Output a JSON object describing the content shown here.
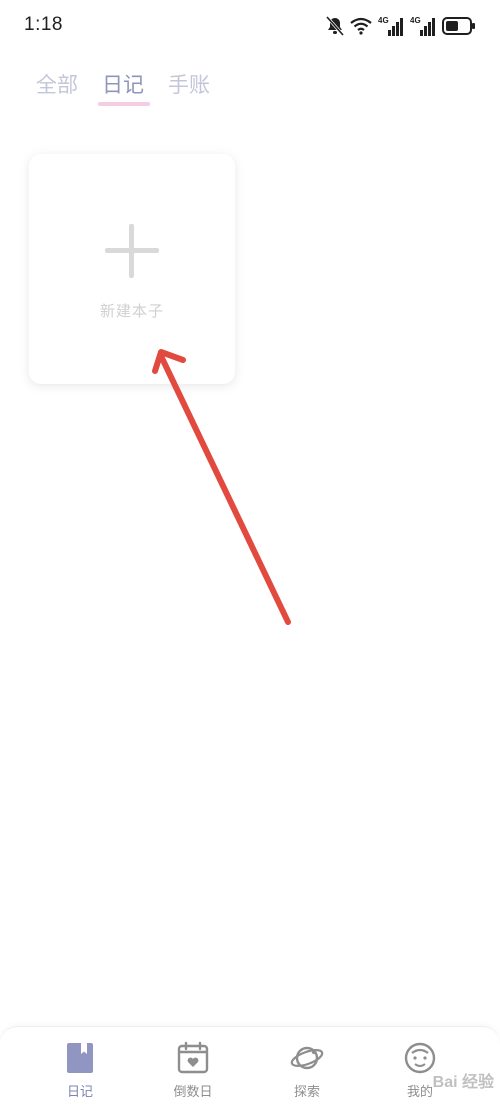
{
  "status_bar": {
    "time": "1:18",
    "network_labels": [
      "4G",
      "4G"
    ]
  },
  "tabs": [
    {
      "label": "全部",
      "active": false
    },
    {
      "label": "日记",
      "active": true
    },
    {
      "label": "手账",
      "active": false
    }
  ],
  "new_notebook": {
    "label": "新建本子"
  },
  "bottom_nav": [
    {
      "label": "日记",
      "icon": "diary-book-icon",
      "active": true
    },
    {
      "label": "倒数日",
      "icon": "countdown-calendar-icon",
      "active": false
    },
    {
      "label": "探索",
      "icon": "planet-icon",
      "active": false
    },
    {
      "label": "我的",
      "icon": "profile-face-icon",
      "active": false
    }
  ],
  "watermark": "Bai 经验",
  "colors": {
    "accent": "#8f96bb",
    "tab_inactive": "#c3c6d8",
    "tab_underline": "#f2cde4",
    "annotation_red": "#e2493f"
  }
}
